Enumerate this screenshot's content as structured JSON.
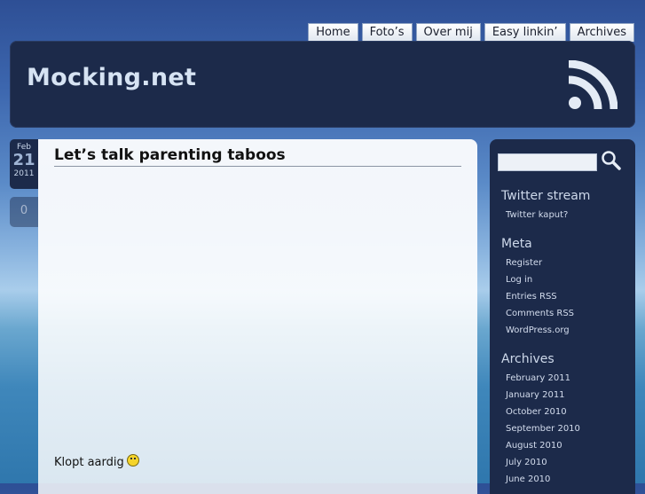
{
  "nav": {
    "items": [
      "Home",
      "Foto’s",
      "Over mij",
      "Easy linkin’",
      "Archives"
    ]
  },
  "header": {
    "title": "Mocking.net",
    "rss_icon": "rss-icon"
  },
  "post": {
    "date": {
      "month": "Feb",
      "day": "21",
      "year": "2011"
    },
    "comment_count": "0",
    "title": "Let’s talk parenting taboos",
    "text": "Klopt aardig",
    "cut_text": "",
    "smiley_icon": "smiley-icon"
  },
  "sidebar": {
    "search": {
      "placeholder": "",
      "icon": "search-icon"
    },
    "twitter": {
      "title": "Twitter stream",
      "message": "Twitter kaput?"
    },
    "meta": {
      "title": "Meta",
      "links": [
        "Register",
        "Log in",
        "Entries RSS",
        "Comments RSS",
        "WordPress.org"
      ]
    },
    "archives": {
      "title": "Archives",
      "links": [
        "February 2011",
        "January 2011",
        "October 2010",
        "September 2010",
        "August 2010",
        "July 2010",
        "June 2010"
      ]
    }
  },
  "colors": {
    "panel": "#1c2a4a",
    "header_text": "#d6e3f3"
  }
}
